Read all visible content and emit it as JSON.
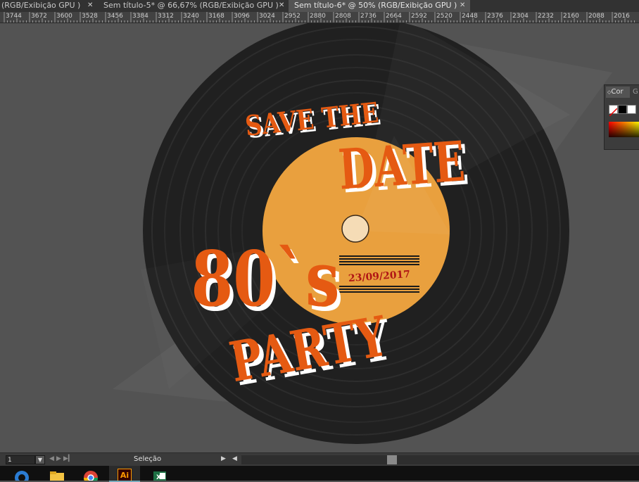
{
  "tabs": [
    {
      "label": "(RGB/Exibição GPU )",
      "active": false
    },
    {
      "label": "Sem título-5* @ 66,67% (RGB/Exibição GPU )",
      "active": false
    },
    {
      "label": "Sem título-6* @ 50% (RGB/Exibição GPU )",
      "active": true
    }
  ],
  "ruler": {
    "labels": [
      "3744",
      "3672",
      "3600",
      "3528",
      "3456",
      "3384",
      "3312",
      "3240",
      "3168",
      "3096",
      "3024",
      "2952",
      "2880",
      "2808",
      "2736",
      "2664",
      "2592",
      "2520",
      "2448",
      "2376",
      "2304",
      "2232",
      "2160",
      "2088",
      "2016"
    ]
  },
  "artwork": {
    "line1": "SAVE THE",
    "line2": "DATE",
    "line3": "80`s",
    "line4": "PARTY",
    "date": "23/09/2017",
    "colors": {
      "background": "#535353",
      "record": "#222222",
      "label": "#e9a03e",
      "spindle": "#f5dcb6",
      "title": "#e55a12",
      "shadow": "#ffffff",
      "date": "#b01515"
    }
  },
  "color_panel": {
    "tab": "Cor",
    "tab2": "G"
  },
  "statusbar": {
    "zoom": "1",
    "tool": "Seleção"
  },
  "taskbar": {
    "apps": [
      "edge-icon",
      "folder-icon",
      "chrome-icon",
      "illustrator-icon",
      "excel-icon"
    ],
    "ai_label": "Ai"
  }
}
